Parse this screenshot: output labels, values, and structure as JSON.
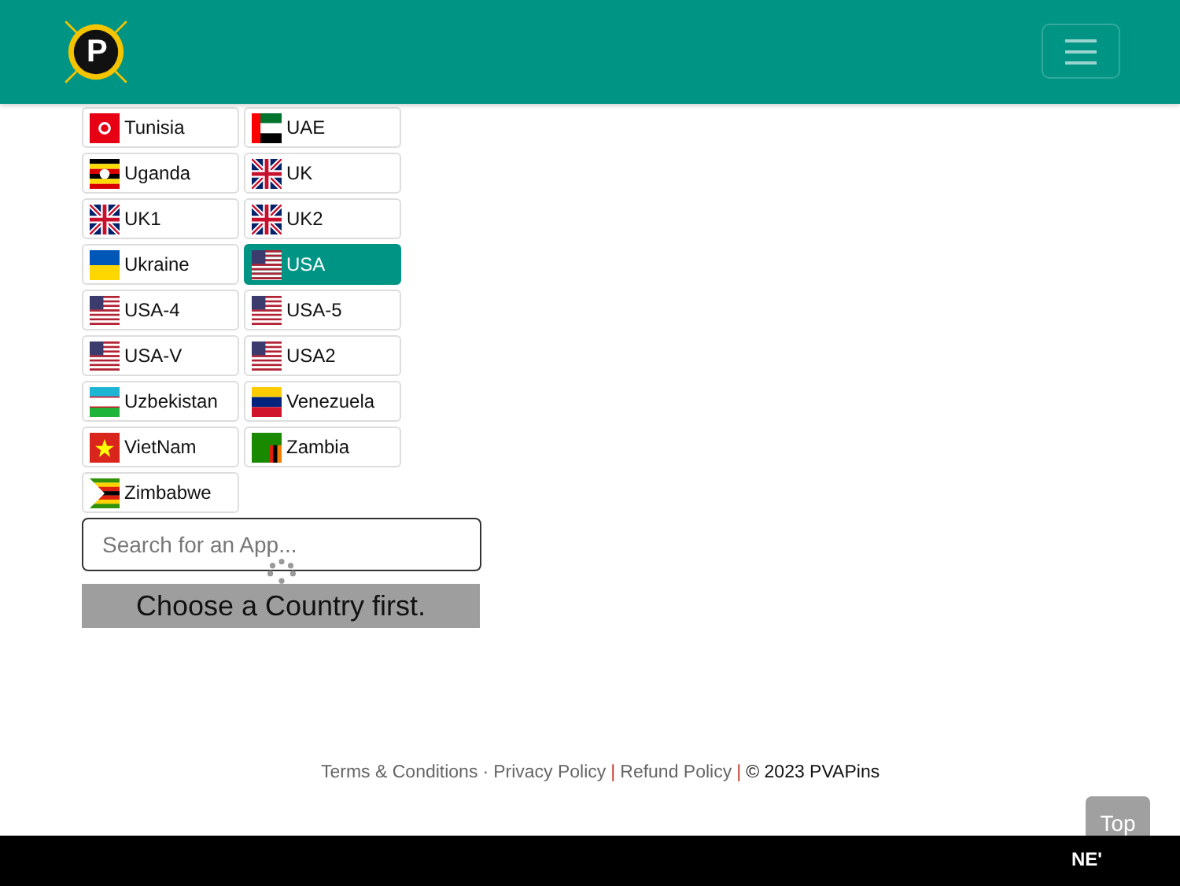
{
  "header": {
    "logo_letter": "P"
  },
  "countries": [
    {
      "label": "Tunisia",
      "kind": "tn",
      "selected": false
    },
    {
      "label": "UAE",
      "kind": "ae",
      "selected": false
    },
    {
      "label": "Uganda",
      "kind": "ug",
      "selected": false
    },
    {
      "label": "UK",
      "kind": "gb",
      "selected": false
    },
    {
      "label": "UK1",
      "kind": "gb",
      "selected": false
    },
    {
      "label": "UK2",
      "kind": "gb",
      "selected": false
    },
    {
      "label": "Ukraine",
      "kind": "ua",
      "selected": false
    },
    {
      "label": "USA",
      "kind": "us",
      "selected": true
    },
    {
      "label": "USA-4",
      "kind": "us",
      "selected": false
    },
    {
      "label": "USA-5",
      "kind": "us",
      "selected": false
    },
    {
      "label": "USA-V",
      "kind": "us",
      "selected": false
    },
    {
      "label": "USA2",
      "kind": "us",
      "selected": false
    },
    {
      "label": "Uzbekistan",
      "kind": "uz",
      "selected": false
    },
    {
      "label": "Venezuela",
      "kind": "ve",
      "selected": false
    },
    {
      "label": "VietNam",
      "kind": "vn",
      "selected": false
    },
    {
      "label": "Zambia",
      "kind": "zm",
      "selected": false
    },
    {
      "label": "Zimbabwe",
      "kind": "zw",
      "selected": false
    }
  ],
  "search": {
    "placeholder": "Search for an App..."
  },
  "notice": "Choose a Country first.",
  "footer": {
    "links": [
      "Terms & Conditions",
      "Privacy Policy",
      "Refund Policy"
    ],
    "separators": [
      "·",
      "|",
      "|"
    ],
    "copyright": "© 2023 PVAPins"
  },
  "top_button": "Top",
  "bottom_bar": {
    "text": "NE'"
  }
}
